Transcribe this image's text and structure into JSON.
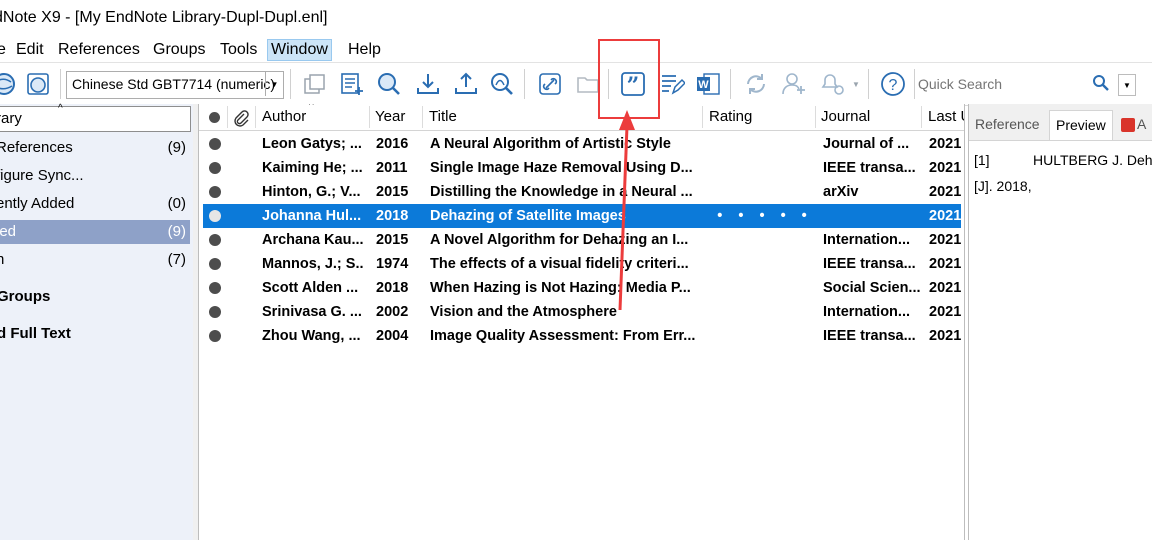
{
  "window": {
    "title": "dNote X9 - [My EndNote Library-Dupl-Dupl.enl]"
  },
  "menu": [
    "e",
    "Edit",
    "References",
    "Groups",
    "Tools",
    "Window",
    "Help"
  ],
  "menu_active": "Window",
  "toolbar": {
    "style_value": "Chinese Std GBT7714 (numeric)",
    "quick_search_placeholder": "Quick Search",
    "insert_citation_icon_glyph": "”"
  },
  "left_pane": {
    "library_label": "rary",
    "groups": [
      {
        "label": "References",
        "count": "(9)"
      },
      {
        "label": "figure Sync...",
        "count": ""
      },
      {
        "label": "ently Added",
        "count": "(0)"
      },
      {
        "label": "led",
        "count": "(9)"
      },
      {
        "label": "h",
        "count": "(7)"
      }
    ],
    "my_groups_label": "Groups",
    "find_full_text_label": "d Full Text"
  },
  "table": {
    "columns": [
      "Author",
      "Year",
      "Title",
      "Rating",
      "Journal",
      "Last U"
    ],
    "rows": [
      {
        "author": "Leon Gatys; ...",
        "year": "2016",
        "title": "A Neural Algorithm of Artistic Style",
        "rating": "",
        "journal": "Journal of ...",
        "last": "2021"
      },
      {
        "author": "Kaiming He; ...",
        "year": "2011",
        "title": "Single Image Haze Removal Using D...",
        "rating": "",
        "journal": "IEEE transa...",
        "last": "2021"
      },
      {
        "author": "Hinton, G.; V...",
        "year": "2015",
        "title": "Distilling the Knowledge in a Neural ...",
        "rating": "",
        "journal": "arXiv",
        "last": "2021"
      },
      {
        "author": "Johanna Hul...",
        "year": "2018",
        "title": "Dehazing of Satellite Images",
        "rating": "• • • • •",
        "journal": "",
        "last": "2021"
      },
      {
        "author": "Archana Kau...",
        "year": "2015",
        "title": "A Novel Algorithm for Dehazing an I...",
        "rating": "",
        "journal": "Internation...",
        "last": "2021"
      },
      {
        "author": "Mannos, J.; S...",
        "year": "1974",
        "title": "The effects of a visual fidelity criteri...",
        "rating": "",
        "journal": "IEEE transa...",
        "last": "2021"
      },
      {
        "author": "Scott Alden ...",
        "year": "2018",
        "title": "When Hazing is Not Hazing: Media P...",
        "rating": "",
        "journal": "Social Scien...",
        "last": "2021"
      },
      {
        "author": "Srinivasa G. ...",
        "year": "2002",
        "title": "Vision and the Atmosphere",
        "rating": "",
        "journal": "Internation...",
        "last": "2021"
      },
      {
        "author": "Zhou Wang, ...",
        "year": "2004",
        "title": "Image Quality Assessment: From Err...",
        "rating": "",
        "journal": "IEEE transa...",
        "last": "2021"
      }
    ],
    "selected_row_index": 3
  },
  "right_pane": {
    "tabs": [
      "Reference",
      "Preview",
      "A"
    ],
    "active_tab": "Preview",
    "preview_line1_num": "[1]",
    "preview_line1_text": "HULTBERG J. Deha",
    "preview_line2": "[J]. 2018,"
  },
  "colors": {
    "selection": "#0c7ad9",
    "group_selected": "#8ea1c8",
    "annotation": "#ec3c3c",
    "icon_blue": "#2a6db2"
  }
}
